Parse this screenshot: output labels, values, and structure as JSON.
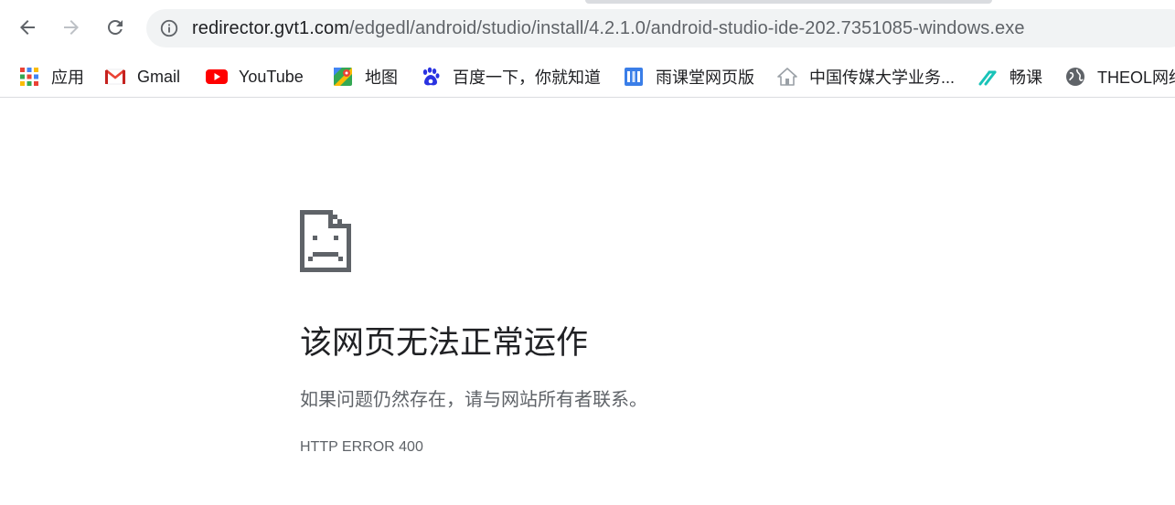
{
  "toolbar": {
    "back_icon": "arrow-left-icon",
    "forward_icon": "arrow-right-icon",
    "reload_icon": "reload-icon",
    "info_icon": "info-icon",
    "url_host": "redirector.gvt1.com",
    "url_path": "/edgedl/android/studio/install/4.2.1.0/android-studio-ide-202.7351085-windows.exe"
  },
  "bookmarks": [
    {
      "label": "应用",
      "icon": "apps-grid-icon"
    },
    {
      "label": "Gmail",
      "icon": "gmail-icon"
    },
    {
      "label": "YouTube",
      "icon": "youtube-icon"
    },
    {
      "label": "地图",
      "icon": "maps-icon"
    },
    {
      "label": "百度一下，你就知道",
      "icon": "baidu-icon"
    },
    {
      "label": "雨课堂网页版",
      "icon": "yuketang-icon"
    },
    {
      "label": "中国传媒大学业务...",
      "icon": "house-icon"
    },
    {
      "label": "畅课",
      "icon": "changke-icon"
    },
    {
      "label": "THEOL网络",
      "icon": "globe-icon"
    }
  ],
  "error": {
    "icon": "sad-page-icon",
    "title": "该网页无法正常运作",
    "message": "如果问题仍然存在，请与网站所有者联系。",
    "code": "HTTP ERROR 400"
  }
}
